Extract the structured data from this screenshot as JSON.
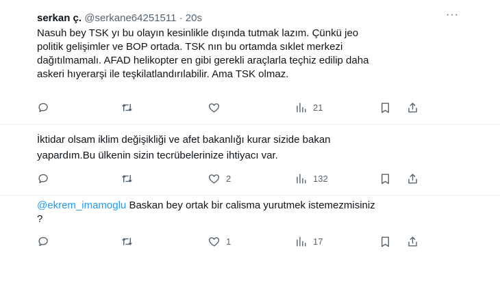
{
  "tweets": [
    {
      "display_name": "serkan ç.",
      "handle": "@serkane64251511",
      "separator": "·",
      "time": "20s",
      "more": "···",
      "text": "Nasuh bey TSK yı bu olayın kesinlikle dışında tutmak lazım. Çünkü jeo\npolitik gelişimler ve BOP ortada. TSK nın bu ortamda sıklet merkezi\ndağıtılmamalı. AFAD helikopter en gibi gerekli araçlarla teçhiz edilip daha\naskeri hıyerarşi ile teşkilatlandırılabilir. Ama TSK olmaz.",
      "likes": "",
      "views": "21"
    },
    {
      "text": "İktidar olsam iklim değişikliği ve afet bakanlığı kurar sizide bakan\nyapardım.Bu ülkenin sizin tecrübelerinize ihtiyacı var.",
      "likes": "2",
      "views": "132"
    },
    {
      "mention": "@ekrem_imamoglu",
      "text": "  Baskan bey ortak bir calisma yurutmek istemezmisiniz\n?",
      "likes": "1",
      "views": "17"
    }
  ],
  "icons": {
    "reply": "reply-icon",
    "retweet": "retweet-icon",
    "like": "heart-icon",
    "views": "views-chart-icon",
    "bookmark": "bookmark-icon",
    "share": "share-icon"
  },
  "colors": {
    "text": "#0f1419",
    "secondary": "#536471",
    "mention": "#1d9bf0",
    "divider": "#eff3f4"
  }
}
